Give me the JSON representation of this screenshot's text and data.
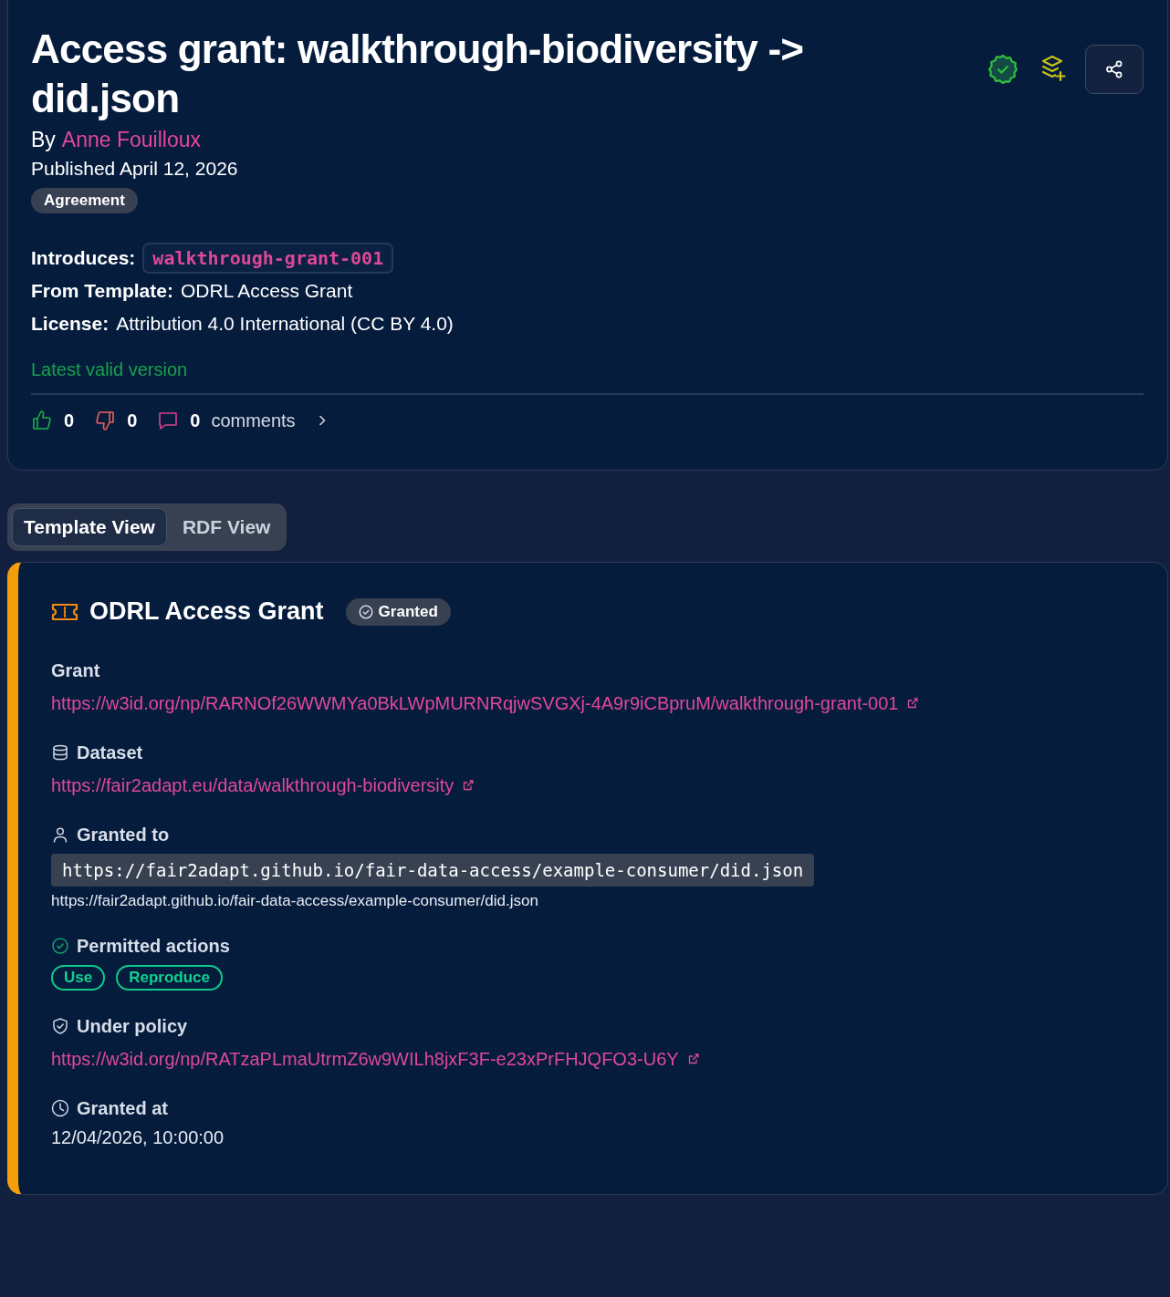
{
  "header": {
    "title": "Access grant: walkthrough-biodiversity -> did.json",
    "by_label": "By",
    "author": "Anne Fouilloux",
    "published": "Published April 12, 2026",
    "type_tag": "Agreement",
    "status_valid": true
  },
  "meta": [
    {
      "label": "Introduces:",
      "value": "walkthrough-grant-001",
      "kind": "code"
    },
    {
      "label": "From Template:",
      "value": "ODRL Access Grant",
      "kind": "text"
    },
    {
      "label": "License:",
      "value": "Attribution 4.0 International (CC BY 4.0)",
      "kind": "text"
    }
  ],
  "version_note": "Latest valid version",
  "reactions": {
    "likes": "0",
    "dislikes": "0",
    "comments": "0",
    "comments_label": "comments"
  },
  "tabs": [
    {
      "label": "Template View",
      "selected": true
    },
    {
      "label": "RDF View",
      "selected": false
    }
  ],
  "template": {
    "title": "ODRL Access Grant",
    "status": "Granted",
    "fields": [
      {
        "kind": "grant",
        "label": "Grant",
        "value": "https://w3id.org/np/RARNOf26WWMYa0BkLWpMURNRqjwSVGXj-4A9r9iCBpruM/walkthrough-grant-001"
      },
      {
        "kind": "dataset",
        "label": "Dataset",
        "value": "https://fair2adapt.eu/data/walkthrough-biodiversity"
      },
      {
        "kind": "agent",
        "label": "Granted to",
        "value": "https://fair2adapt.github.io/fair-data-access/example-consumer/did.json",
        "caption": "https://fair2adapt.github.io/fair-data-access/example-consumer/did.json"
      },
      {
        "kind": "actions",
        "label": "Permitted actions",
        "tags": [
          "Use",
          "Reproduce"
        ]
      },
      {
        "kind": "policy",
        "label": "Under policy",
        "value": "https://w3id.org/np/RATzaPLmaUtrmZ6w9WILh8jxF3F-e23xPrFHJQFO3-U6Y"
      },
      {
        "kind": "time",
        "label": "Granted at",
        "value": "12/04/2026, 10:00:00"
      }
    ]
  }
}
